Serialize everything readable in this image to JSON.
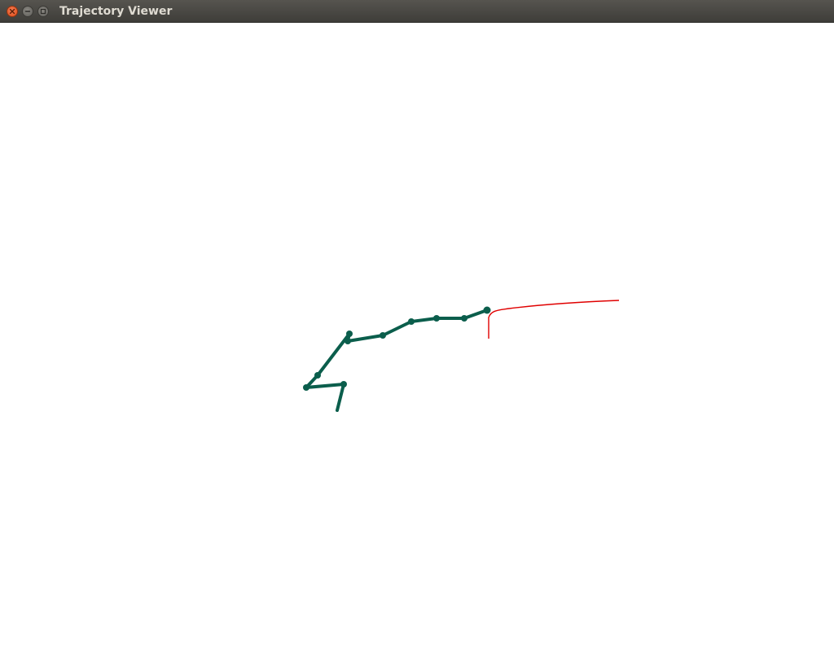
{
  "window": {
    "title": "Trajectory Viewer"
  },
  "controls": {
    "close_icon": "close-icon",
    "minimize_icon": "minimize-icon",
    "maximize_icon": "maximize-icon"
  },
  "colors": {
    "robot_arm": "#0b5e4c",
    "trajectory": "#e00000",
    "background": "#ffffff"
  }
}
